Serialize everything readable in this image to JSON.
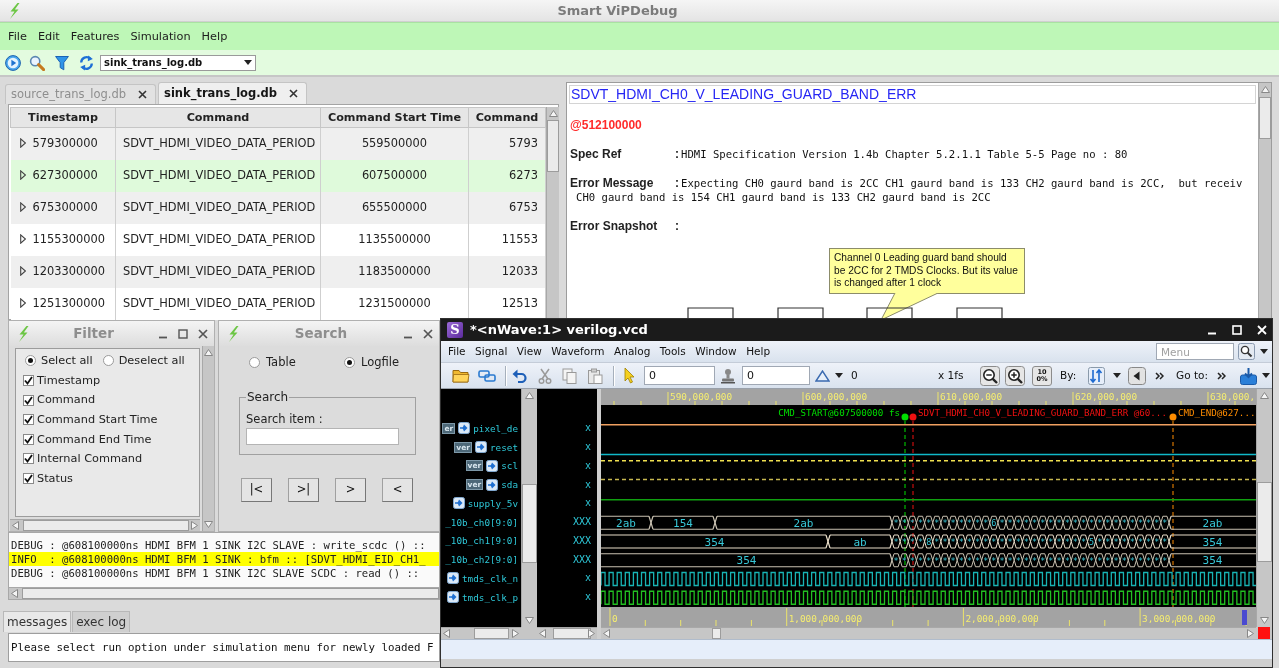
{
  "window": {
    "title": "Smart ViPDebug"
  },
  "menu": [
    {
      "label": "File"
    },
    {
      "label": "Edit"
    },
    {
      "label": "Features"
    },
    {
      "label": "Simulation"
    },
    {
      "label": "Help"
    }
  ],
  "toolbar": {
    "database": "sink_trans_log.db"
  },
  "tabs": [
    {
      "label": "source_trans_log.db",
      "selected": false
    },
    {
      "label": "sink_trans_log.db",
      "selected": true
    }
  ],
  "table": {
    "columns": [
      "Timestamp",
      "Command",
      "Command Start Time",
      "Command"
    ],
    "rows": [
      {
        "cells": [
          "579300000",
          "SDVT_HDMI_VIDEO_DATA_PERIOD",
          "559500000",
          "5793"
        ],
        "selected": false
      },
      {
        "cells": [
          "627300000",
          "SDVT_HDMI_VIDEO_DATA_PERIOD",
          "607500000",
          "6273"
        ],
        "selected": true
      },
      {
        "cells": [
          "675300000",
          "SDVT_HDMI_VIDEO_DATA_PERIOD",
          "655500000",
          "6753"
        ],
        "selected": false
      },
      {
        "cells": [
          "1155300000",
          "SDVT_HDMI_VIDEO_DATA_PERIOD",
          "1135500000",
          "11553"
        ],
        "selected": false
      },
      {
        "cells": [
          "1203300000",
          "SDVT_HDMI_VIDEO_DATA_PERIOD",
          "1183500000",
          "12033"
        ],
        "selected": false
      },
      {
        "cells": [
          "1251300000",
          "SDVT_HDMI_VIDEO_DATA_PERIOD",
          "1231500000",
          "12513"
        ],
        "selected": false
      }
    ]
  },
  "report": {
    "title": "SDVT_HDMI_CH0_V_LEADING_GUARD_BAND_ERR",
    "time": "@512100000",
    "fields": [
      {
        "label": "Spec Ref",
        "separator": ":",
        "lines": [
          "HDMI Specification Version 1.4b Chapter 5.2.1.1 Table 5-5 Page no : 80"
        ]
      },
      {
        "label": "Error Message",
        "separator": ":",
        "lines": [
          "Expecting CH0 gaurd band is 2CC CH1 gaurd band is 133 CH2 gaurd band is 2CC,  but receiv",
          "CH0 gaurd band is 154 CH1 gaurd band is 133 CH2 gaurd band is 2CC"
        ]
      },
      {
        "label": "Error Snapshot",
        "separator": ":"
      }
    ],
    "callout": "Channel 0 Leading guard band should be 2CC for 2 TMDS Clocks. But its value is changed after 1 clock"
  },
  "filter_window": {
    "title": "Filter",
    "radios": [
      {
        "label": "Select all",
        "selected": true
      },
      {
        "label": "Deselect all",
        "selected": false
      }
    ],
    "checkboxes": [
      {
        "label": "Timestamp",
        "checked": true
      },
      {
        "label": "Command",
        "checked": true
      },
      {
        "label": "Command Start Time",
        "checked": true
      },
      {
        "label": "Command End Time",
        "checked": true
      },
      {
        "label": "Internal Command",
        "checked": true
      },
      {
        "label": "Status",
        "checked": true
      }
    ]
  },
  "search_window": {
    "title": "Search",
    "radios": [
      {
        "label": "Table",
        "selected": false
      },
      {
        "label": "Logfile",
        "selected": true
      }
    ],
    "group": "Search",
    "field_label": "Search item :",
    "buttons": [
      "|<",
      ">|",
      ">",
      "<"
    ]
  },
  "log": [
    {
      "text": "DEBUG : @608100000ns HDMI BFM 1 SINK I2C SLAVE : write_scdc () ::",
      "highlighted": false
    },
    {
      "text": "INFO  : @608100000ns HDMI BFM 1 SINK : bfm :: [SDVT_HDMI_EID_CH1_",
      "highlighted": true
    },
    {
      "text": "DEBUG : @608100000ns HDMI BFM 1 SINK I2C SLAVE SCDC : read () ::",
      "highlighted": false
    }
  ],
  "bottom_tabs": [
    {
      "label": "messages",
      "selected": true
    },
    {
      "label": "exec log",
      "selected": false
    }
  ],
  "message": "Please select run option under simulation menu for newly loaded F",
  "nwave": {
    "logo": "S",
    "title": "*<nWave:1> verilog.vcd",
    "menu": [
      {
        "label": "File"
      },
      {
        "label": "Signal"
      },
      {
        "label": "View"
      },
      {
        "label": "Waveform"
      },
      {
        "label": "Analog"
      },
      {
        "label": "Tools"
      },
      {
        "label": "Window"
      },
      {
        "label": "Help"
      }
    ],
    "menu_search": {
      "placeholder": "Menu"
    },
    "toolbar": {
      "cursor_time": "0",
      "marker_time": "0",
      "delta": "0",
      "scale": "x 1fs",
      "zoom_all": "100%",
      "by_label": "By:",
      "goto_label": "Go to:"
    },
    "ruler": [
      "590,000,000",
      "600,000,000",
      "610,000,000",
      "620,000,000",
      "630,000,"
    ],
    "markers": [
      {
        "label": "CMD_START@607500000 fs",
        "color": "#00dd00"
      },
      {
        "label": "SDVT_HDMI_CH0_V_LEADING_GUARD_BAND_ERR @60...",
        "color": "#ee1111"
      },
      {
        "label": "CMD_END@627...",
        "color": "#ff8c00"
      }
    ],
    "signals": [
      {
        "name": "pixel_de",
        "tag": "er",
        "value": "x",
        "kind": "high",
        "color": "#f0a060"
      },
      {
        "name": "reset",
        "tag": "ver",
        "value": "x",
        "kind": "low",
        "color": "#10b8c8"
      },
      {
        "name": "scl",
        "tag": "ver",
        "value": "x",
        "kind": "dashed",
        "color": "#f0e050"
      },
      {
        "name": "sda",
        "tag": "ver",
        "value": "x",
        "kind": "dashed",
        "color": "#c8b850"
      },
      {
        "name": "supply_5v",
        "value": "x",
        "kind": "high",
        "color": "#10a010"
      },
      {
        "name": "_10b_ch0[9:0]",
        "value": "XXX",
        "kind": "bus",
        "color": "#c8c0b0",
        "segments": [
          {
            "kind": "value",
            "value": "2ab"
          },
          {
            "kind": "value",
            "value": "154"
          },
          {
            "kind": "value",
            "value": "2ab"
          },
          {
            "kind": "burst",
            "value": "************6*********************"
          },
          {
            "kind": "value",
            "value": "2ab"
          }
        ]
      },
      {
        "name": "_10b_ch1[9:0]",
        "value": "XXX",
        "kind": "bus",
        "color": "#e8dcc8",
        "segments": [
          {
            "kind": "value",
            "value": "354"
          },
          {
            "kind": "value",
            "value": "ab"
          },
          {
            "kind": "burst",
            "value": "****8*******************5*********"
          },
          {
            "kind": "value",
            "value": "354"
          }
        ]
      },
      {
        "name": "_10b_ch2[9:0]",
        "value": "XXX",
        "kind": "bus",
        "color": "#c8c0b0",
        "segments": [
          {
            "kind": "value",
            "value": "354"
          },
          {
            "kind": "burst",
            "value": "**********************************"
          },
          {
            "kind": "value",
            "value": "354"
          }
        ]
      },
      {
        "name": "tmds_clk_n",
        "value": "x",
        "kind": "clock",
        "color": "#18b4b4"
      },
      {
        "name": "tmds_clk_p",
        "value": "x",
        "kind": "clock",
        "color": "#22c022"
      }
    ],
    "overview_ruler": [
      "0",
      "1,000,000,000",
      "2,000,000,000",
      "3,000,000,000"
    ]
  }
}
